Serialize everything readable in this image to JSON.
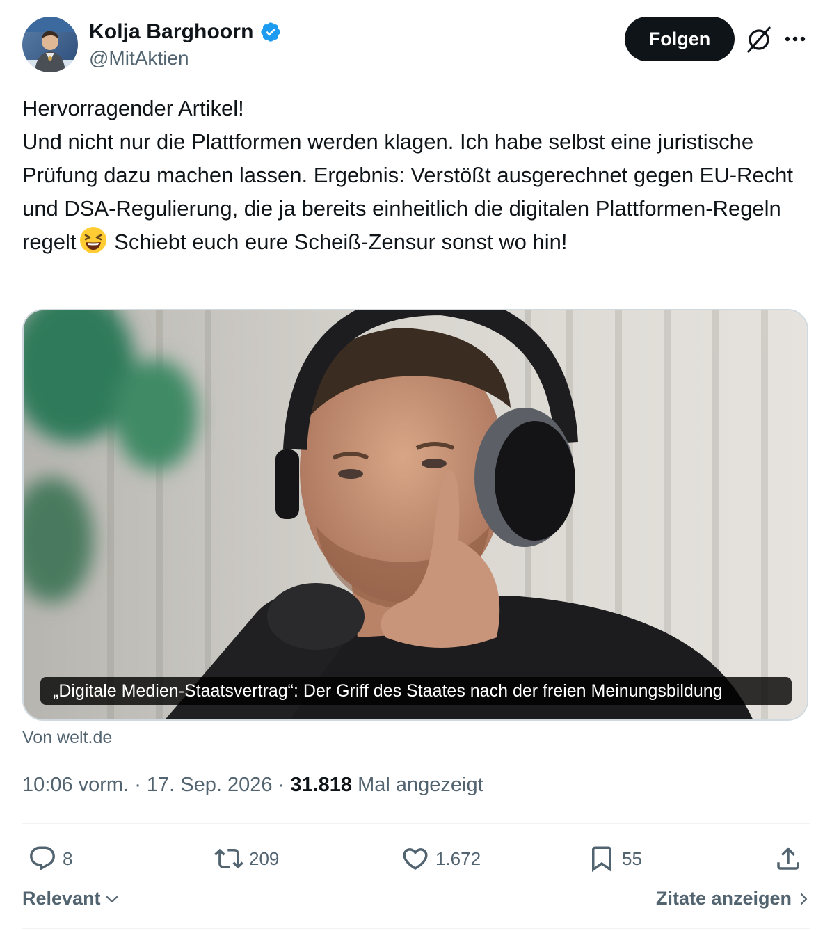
{
  "author": {
    "display_name": "Kolja Barghoorn",
    "handle": "@MitAktien",
    "verified": true,
    "avatar_icon": "profile-photo"
  },
  "header": {
    "follow_label": "Folgen",
    "grok_icon": "grok-icon",
    "more_icon": "more-icon"
  },
  "tweet": {
    "line1": "Hervorragender Artikel!",
    "body_part1": "Und nicht nur die Plattformen werden klagen. Ich habe selbst eine juristische Prüfung dazu machen lassen. Ergebnis: Verstößt ausgerechnet gegen EU-Recht und DSA-Regulierung, die ja bereits einheitlich die digitalen Plattformen-Regeln regelt",
    "emoji": "laughing-face-emoji",
    "body_part2": " Schiebt euch eure Scheiß-Zensur sonst wo hin!"
  },
  "card": {
    "caption": "„Digitale Medien-Staatsvertrag“: Der Griff des Staates nach der freien Meinungsbildung",
    "source": "Von welt.de"
  },
  "meta": {
    "time": "10:06 vorm.",
    "sep": " · ",
    "date": "17. Sep. 2026",
    "views": "31.818",
    "views_label": " Mal angezeigt"
  },
  "actions": {
    "replies": "8",
    "reposts": "209",
    "likes": "1.672",
    "bookmarks": "55"
  },
  "footer": {
    "sort_label": "Relevant",
    "quotes_label": "Zitate anzeigen"
  },
  "colors": {
    "text": "#0f1419",
    "secondary": "#536471",
    "verified": "#1d9bf0",
    "divider": "#eff3f4"
  }
}
